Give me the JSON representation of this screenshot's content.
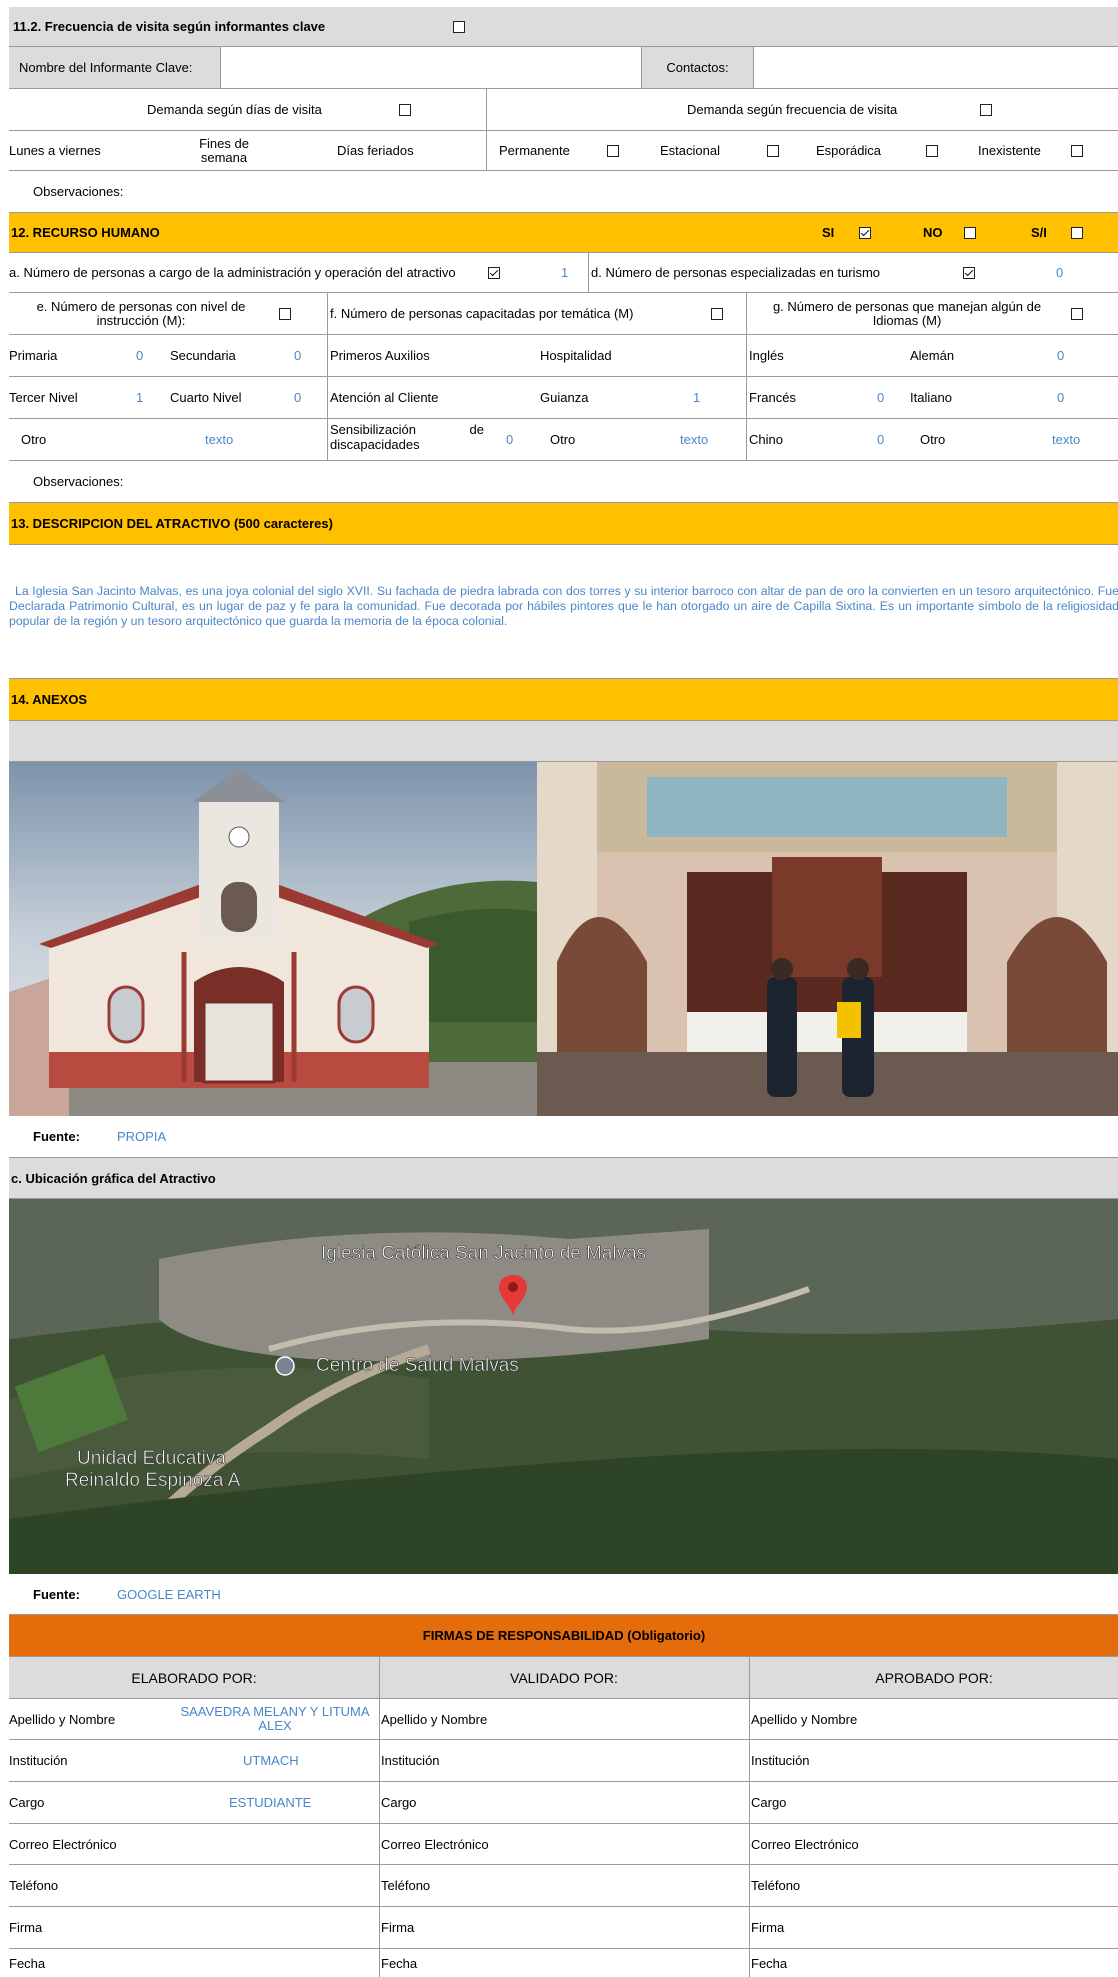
{
  "s11": {
    "title": "11.2. Frecuencia de visita según informantes clave",
    "nombre_label": "Nombre del Informante Clave:",
    "contactos_label": "Contactos:",
    "dias_label": "Demanda según  días de visita",
    "frec_label": "Demanda según frecuencia de visita",
    "lunes": "Lunes a viernes",
    "fines": "Fines de semana",
    "feriados": "Días feriados",
    "permanente": "Permanente",
    "estacional": "Estacional",
    "esporadica": "Esporádica",
    "inexistente": "Inexistente",
    "obs": "Observaciones:"
  },
  "s12": {
    "title": "12. RECURSO HUMANO",
    "si": "SI",
    "no": "NO",
    "si_checked": true,
    "sin_info": "S/I",
    "a_label": "a. Número de personas a cargo de la administración y operación del atractivo",
    "a_val": "1",
    "d_label": "d. Número de personas especializadas en turismo",
    "d_val": "0",
    "e_label": "e. Número de personas con nivel de instrucción (M):",
    "f_label": "f. Número de personas capacitadas por temática (M)",
    "g_label": "g. Número de personas que manejan algún de Idiomas (M)",
    "primaria": "Primaria",
    "primaria_val": "0",
    "secundaria": "Secundaria",
    "secundaria_val": "0",
    "tercer": "Tercer Nivel",
    "tercer_val": "1",
    "cuarto": "Cuarto Nivel",
    "cuarto_val": "0",
    "otro": "Otro",
    "otro_val": "texto",
    "auxilios": "Primeros Auxilios",
    "hospitalidad": "Hospitalidad",
    "atencion": "Atención al Cliente",
    "guianza": "Guianza",
    "guianza_val": "1",
    "sensib_1": "Sensibilización",
    "sensib_de": "de",
    "sensib_2": "discapacidades",
    "sensib_val": "0",
    "otro_f": "Otro",
    "otro_f_val": "texto",
    "ingles": "Inglés",
    "aleman": "Alemán",
    "aleman_val": "0",
    "frances": "Francés",
    "frances_val": "0",
    "italiano": "Italiano",
    "italiano_val": "0",
    "chino": "Chino",
    "chino_val": "0",
    "otro_g": "Otro",
    "otro_g_val": "texto",
    "obs": "Observaciones:"
  },
  "s13": {
    "title": "13. DESCRIPCION DEL ATRACTIVO (500 caracteres)",
    "text": "La Iglesia San Jacinto Malvas, es una joya colonial del siglo XVII. Su fachada de piedra labrada con dos torres y su interior barroco con altar de pan de oro la convierten en un tesoro arquitectónico. Fue Declarada Patrimonio Cultural, es un lugar de paz y fe para la comunidad. Fue decorada por hábiles pintores que le han otorgado un aire de Capilla Sixtina. Es un importante símbolo de la religiosidad popular de la región y un tesoro arquitectónico que guarda la memoria de la época colonial."
  },
  "s14": {
    "title": "14. ANEXOS",
    "fuente_label": "Fuente:",
    "fuente_val": "PROPIA"
  },
  "map": {
    "title": "c. Ubicación gráfica del Atractivo",
    "label_church": "Iglesia Católica San Jacinto de Malvas",
    "label_salud": "Centro de Salud Malvas",
    "label_school_1": "Unidad Educativa",
    "label_school_2": "Reinaldo Espinoza A",
    "fuente_label": "Fuente:",
    "fuente_val": "GOOGLE EARTH"
  },
  "firmas": {
    "title": "FIRMAS DE RESPONSABILIDAD (Obligatorio)",
    "elaborado": "ELABORADO POR:",
    "validado": "VALIDADO  POR:",
    "aprobado": "APROBADO POR:",
    "apellido": "Apellido y Nombre",
    "apellido_val": "SAAVEDRA MELANY Y LITUMA ALEX",
    "institucion": "Institución",
    "institucion_val": "UTMACH",
    "cargo": "Cargo",
    "cargo_val": "ESTUDIANTE",
    "correo": "Correo Electrónico",
    "telefono": "Teléfono",
    "firma": "Firma",
    "fecha": "Fecha"
  },
  "colors": {
    "yellow": "#ffc000",
    "orange": "#e46c0a",
    "gray": "#dcdcdc",
    "blue": "#4a86c8"
  }
}
